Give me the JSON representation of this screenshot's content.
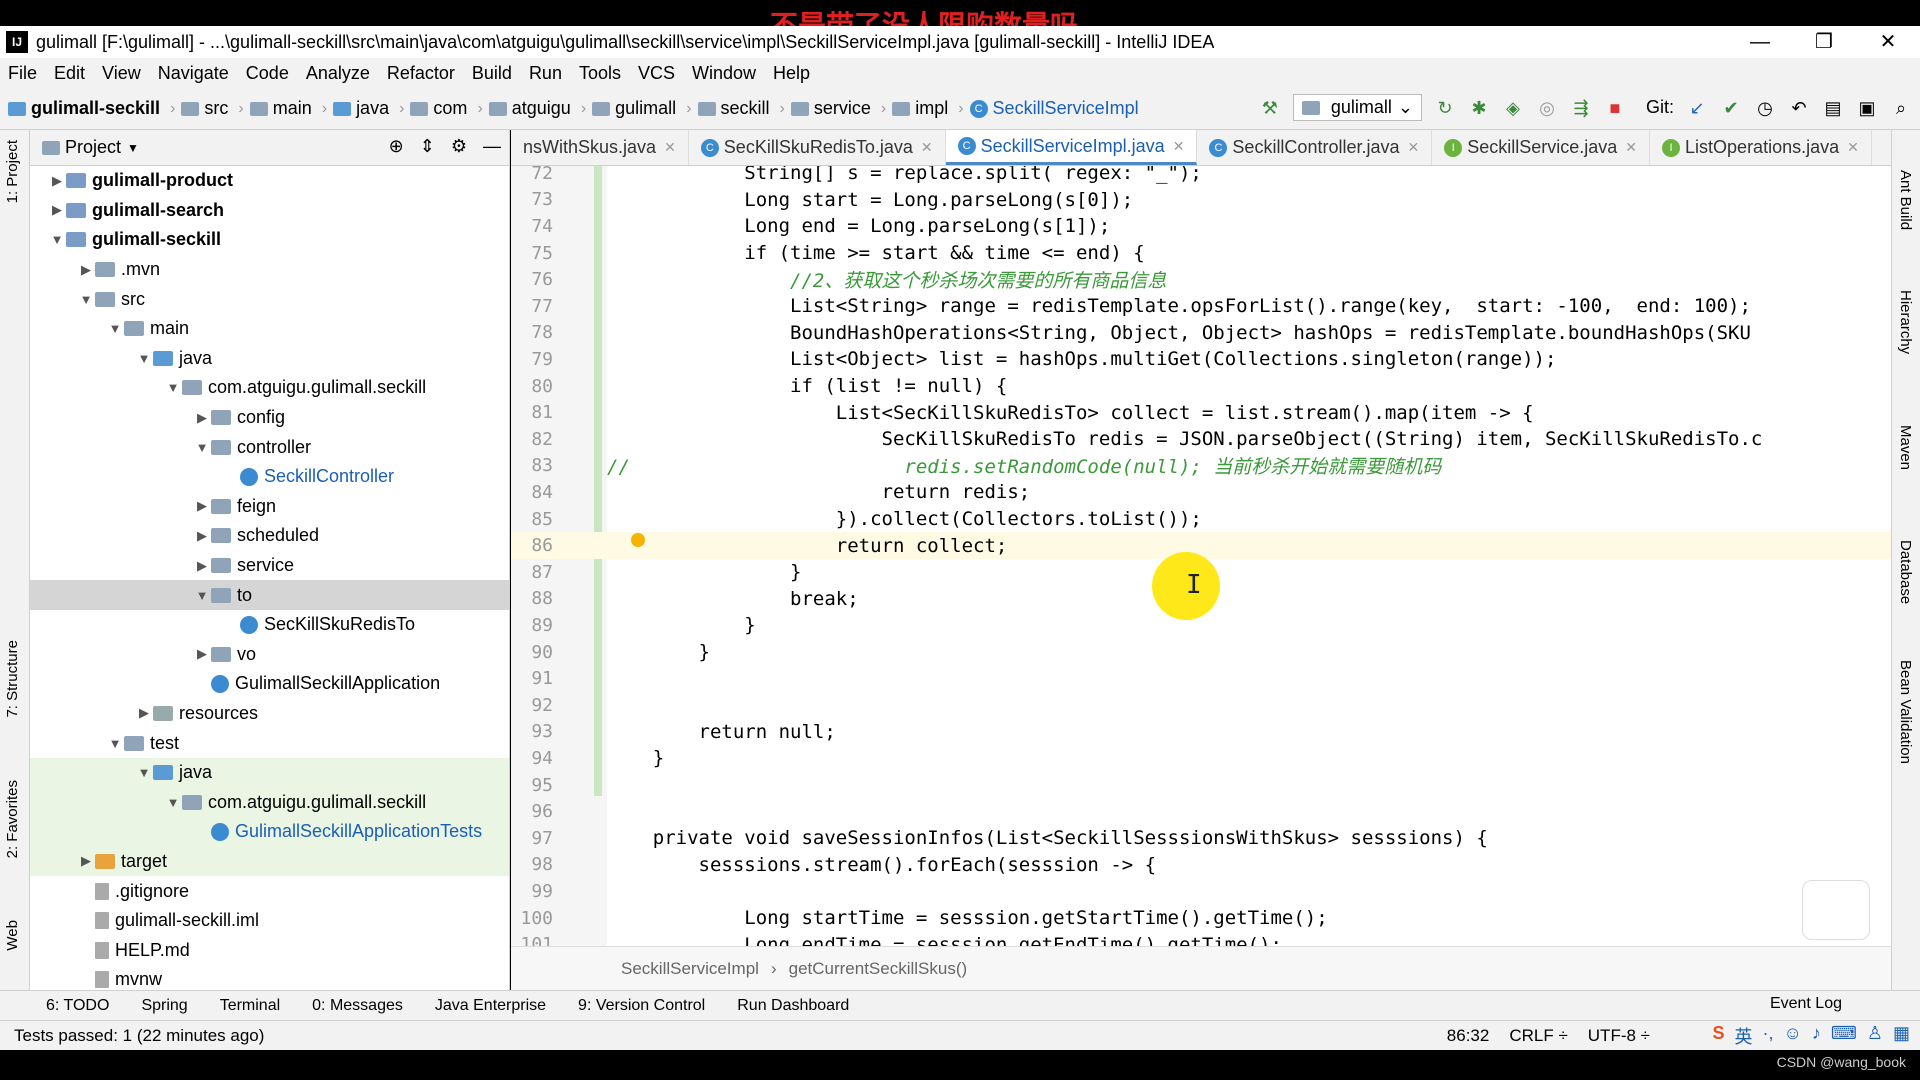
{
  "window": {
    "title": "gulimall [F:\\gulimall] - ...\\gulimall-seckill\\src\\main\\java\\com\\atguigu\\gulimall\\seckill\\service\\impl\\SeckillServiceImpl.java [gulimall-seckill] - IntelliJ IDEA",
    "overlay_caption": "不是带了没人限购数量吗",
    "minimize": "—",
    "restore": "❐",
    "close": "✕"
  },
  "menu": [
    "File",
    "Edit",
    "View",
    "Navigate",
    "Code",
    "Analyze",
    "Refactor",
    "Build",
    "Run",
    "Tools",
    "VCS",
    "Window",
    "Help"
  ],
  "nav": {
    "crumbs": [
      "gulimall-seckill",
      "src",
      "main",
      "java",
      "com",
      "atguigu",
      "gulimall",
      "seckill",
      "service",
      "impl",
      "SeckillServiceImpl"
    ],
    "run_config": "gulimall",
    "git_label": "Git:"
  },
  "left_tabs": {
    "project": "1: Project",
    "structure": "7: Structure",
    "favorites": "2: Favorites",
    "web": "Web"
  },
  "right_tabs": [
    "Ant Build",
    "Hierarchy",
    "Maven",
    "Database",
    "Bean Validation"
  ],
  "project": {
    "header": "Project",
    "tree": [
      {
        "label": "gulimall-product",
        "depth": 0,
        "arrow": "▶",
        "icon": "mod",
        "bold": true
      },
      {
        "label": "gulimall-search",
        "depth": 0,
        "arrow": "▶",
        "icon": "mod",
        "bold": true
      },
      {
        "label": "gulimall-seckill",
        "depth": 0,
        "arrow": "▼",
        "icon": "mod",
        "bold": true
      },
      {
        "label": ".mvn",
        "depth": 1,
        "arrow": "▶",
        "icon": "folder"
      },
      {
        "label": "src",
        "depth": 1,
        "arrow": "▼",
        "icon": "folder"
      },
      {
        "label": "main",
        "depth": 2,
        "arrow": "▼",
        "icon": "folder"
      },
      {
        "label": "java",
        "depth": 3,
        "arrow": "▼",
        "icon": "src"
      },
      {
        "label": "com.atguigu.gulimall.seckill",
        "depth": 4,
        "arrow": "▼",
        "icon": "folder"
      },
      {
        "label": "config",
        "depth": 5,
        "arrow": "▶",
        "icon": "folder"
      },
      {
        "label": "controller",
        "depth": 5,
        "arrow": "▼",
        "icon": "folder"
      },
      {
        "label": "SeckillController",
        "depth": 6,
        "arrow": "",
        "icon": "cls",
        "blue": true
      },
      {
        "label": "feign",
        "depth": 5,
        "arrow": "▶",
        "icon": "folder"
      },
      {
        "label": "scheduled",
        "depth": 5,
        "arrow": "▶",
        "icon": "folder"
      },
      {
        "label": "service",
        "depth": 5,
        "arrow": "▶",
        "icon": "folder"
      },
      {
        "label": "to",
        "depth": 5,
        "arrow": "▼",
        "icon": "folder",
        "selected": true
      },
      {
        "label": "SecKillSkuRedisTo",
        "depth": 6,
        "arrow": "",
        "icon": "cls"
      },
      {
        "label": "vo",
        "depth": 5,
        "arrow": "▶",
        "icon": "folder"
      },
      {
        "label": "GulimallSeckillApplication",
        "depth": 5,
        "arrow": "",
        "icon": "app"
      },
      {
        "label": "resources",
        "depth": 3,
        "arrow": "▶",
        "icon": "res"
      },
      {
        "label": "test",
        "depth": 2,
        "arrow": "▼",
        "icon": "folder"
      },
      {
        "label": "java",
        "depth": 3,
        "arrow": "▼",
        "icon": "src",
        "green": true
      },
      {
        "label": "com.atguigu.gulimall.seckill",
        "depth": 4,
        "arrow": "▼",
        "icon": "folder",
        "green": true
      },
      {
        "label": "GulimallSeckillApplicationTests",
        "depth": 5,
        "arrow": "",
        "icon": "cls",
        "blue": true,
        "green": true
      },
      {
        "label": "target",
        "depth": 1,
        "arrow": "▶",
        "icon": "orange",
        "green": true
      },
      {
        "label": ".gitignore",
        "depth": 1,
        "arrow": "",
        "icon": "file"
      },
      {
        "label": "gulimall-seckill.iml",
        "depth": 1,
        "arrow": "",
        "icon": "file"
      },
      {
        "label": "HELP.md",
        "depth": 1,
        "arrow": "",
        "icon": "file"
      },
      {
        "label": "mvnw",
        "depth": 1,
        "arrow": "",
        "icon": "file"
      }
    ]
  },
  "tabs": [
    {
      "label": "nsWithSkus.java",
      "active": false
    },
    {
      "label": "SecKillSkuRedisTo.java",
      "active": false
    },
    {
      "label": "SeckillServiceImpl.java",
      "active": true
    },
    {
      "label": "SeckillController.java",
      "active": false
    },
    {
      "label": "SeckillService.java",
      "active": false
    },
    {
      "label": "ListOperations.java",
      "active": false
    }
  ],
  "code": [
    {
      "n": "72",
      "html": "            String[] s = replace.split( regex: \"_\");"
    },
    {
      "n": "73",
      "html": "            Long start = Long.parseLong(s[0]);"
    },
    {
      "n": "74",
      "html": "            Long end = Long.parseLong(s[1]);"
    },
    {
      "n": "75",
      "html": "            if (time >= start && time <= end) {"
    },
    {
      "n": "76",
      "html": "                //2、获取这个秒杀场次需要的所有商品信息"
    },
    {
      "n": "77",
      "html": "                List<String> range = redisTemplate.opsForList().range(key,  start: -100,  end: 100);"
    },
    {
      "n": "78",
      "html": "                BoundHashOperations<String, Object, Object> hashOps = redisTemplate.boundHashOps(SKU"
    },
    {
      "n": "79",
      "html": "                List<Object> list = hashOps.multiGet(Collections.singleton(range));"
    },
    {
      "n": "80",
      "html": "                if (list != null) {"
    },
    {
      "n": "81",
      "html": "                    List<SecKillSkuRedisTo> collect = list.stream().map(item -> {"
    },
    {
      "n": "82",
      "html": "                        SecKillSkuRedisTo redis = JSON.parseObject((String) item, SecKillSkuRedisTo.c"
    },
    {
      "n": "83",
      "html": "//                        redis.setRandomCode(null); 当前秒杀开始就需要随机码"
    },
    {
      "n": "84",
      "html": "                        return redis;"
    },
    {
      "n": "85",
      "html": "                    }).collect(Collectors.toList());"
    },
    {
      "n": "86",
      "html": "                    return collect;"
    },
    {
      "n": "87",
      "html": "                }"
    },
    {
      "n": "88",
      "html": "                break;"
    },
    {
      "n": "89",
      "html": "            }"
    },
    {
      "n": "90",
      "html": "        }"
    },
    {
      "n": "91",
      "html": ""
    },
    {
      "n": "92",
      "html": ""
    },
    {
      "n": "93",
      "html": "        return null;"
    },
    {
      "n": "94",
      "html": "    }"
    },
    {
      "n": "95",
      "html": ""
    },
    {
      "n": "96",
      "html": ""
    },
    {
      "n": "97",
      "html": "    private void saveSessionInfos(List<SeckillSesssionsWithSkus> sesssions) {"
    },
    {
      "n": "98",
      "html": "        sesssions.stream().forEach(sesssion -> {"
    },
    {
      "n": "99",
      "html": ""
    },
    {
      "n": "100",
      "html": "            Long startTime = sesssion.getStartTime().getTime();"
    },
    {
      "n": "101",
      "html": "            Long endTime = sesssion.getEndTime().getTime();"
    }
  ],
  "editor_breadcrumb": [
    "SeckillServiceImpl",
    "getCurrentSeckillSkus()"
  ],
  "toolwindows": [
    "6: TODO",
    "Spring",
    "Terminal",
    "0: Messages",
    "Java Enterprise",
    "9: Version Control",
    "Run Dashboard"
  ],
  "event_log": "Event Log",
  "status": {
    "message": "Tests passed: 1 (22 minutes ago)",
    "position": "86:32",
    "line_sep": "CRLF ÷",
    "encoding": "UTF-8 ÷",
    "ime_lang": "英"
  },
  "watermark": "CSDN @wang_book"
}
